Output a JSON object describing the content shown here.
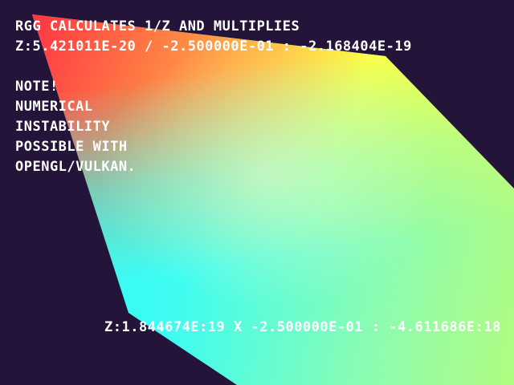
{
  "header": {
    "title": "RGG calculates 1/Z and multiplies",
    "equation": "Z:5.421011E-20 / -2.500000E-01 : -2.168404E-19"
  },
  "note": {
    "lines": [
      "NOTE!",
      "Numerical",
      "instability",
      "possible with",
      "OpenGL/Vulkan."
    ]
  },
  "bottom_equation": "Z:1.844674E:19 x -2.500000E-01 : -4.611686E:18",
  "colors": {
    "background": "#24143a",
    "corner_top_left": "#ff2244",
    "corner_top_right": "#ffff44",
    "corner_bottom_left": "#2ff8ff",
    "corner_bottom_right": "#b0fc80"
  }
}
